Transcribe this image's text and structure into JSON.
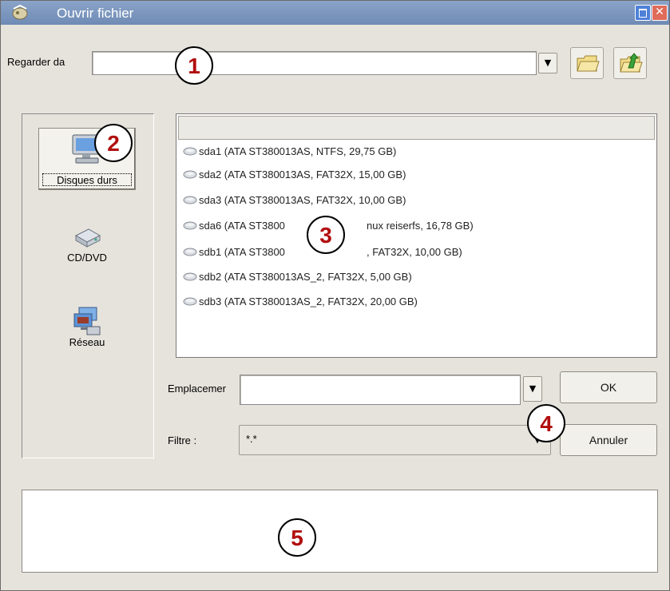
{
  "window": {
    "title": "Ouvrir fichier",
    "close_glyph": "✕"
  },
  "look_in": {
    "label": "Regarder da",
    "value": "",
    "dropdown_glyph": "▼"
  },
  "toolbar": {
    "icons": [
      "folder-open-icon",
      "folder-up-icon"
    ]
  },
  "places": [
    {
      "label": "Disques durs",
      "icon": "computer-icon",
      "selected": true
    },
    {
      "label": "CD/DVD",
      "icon": "cd-drive-icon",
      "selected": false
    },
    {
      "label": "Réseau",
      "icon": "network-icon",
      "selected": false
    }
  ],
  "file_list": {
    "header": "",
    "items": [
      "sda1 (ATA ST380013AS,  NTFS,  29,75 GB)",
      "sda2 (ATA ST380013AS,  FAT32X,  15,00 GB)",
      "sda3 (ATA ST380013AS,  FAT32X,  10,00 GB)",
      "sda6 (ATA ST3800",
      "sdb1 (ATA ST3800",
      "sdb2 (ATA ST380013AS_2,  FAT32X,  5,00 GB)",
      "sdb3 (ATA ST380013AS_2,  FAT32X,  20,00 GB)"
    ],
    "items_tail": [
      "",
      "",
      "",
      "nux reiserfs,  16,78 GB)",
      ",  FAT32X,  10,00 GB)",
      "",
      ""
    ]
  },
  "location": {
    "label": "Emplacemer",
    "value": "",
    "dropdown_glyph": "▼"
  },
  "filter": {
    "label": "Filtre :",
    "value": "*.*",
    "dropdown_glyph": "▼"
  },
  "buttons": {
    "ok": "OK",
    "cancel": "Annuler"
  },
  "callouts": [
    "1",
    "2",
    "3",
    "4",
    "5"
  ],
  "colors": {
    "titlebar": "#7b95be",
    "window_bg": "#e6e3dc",
    "callout_number": "#b10e0e"
  }
}
